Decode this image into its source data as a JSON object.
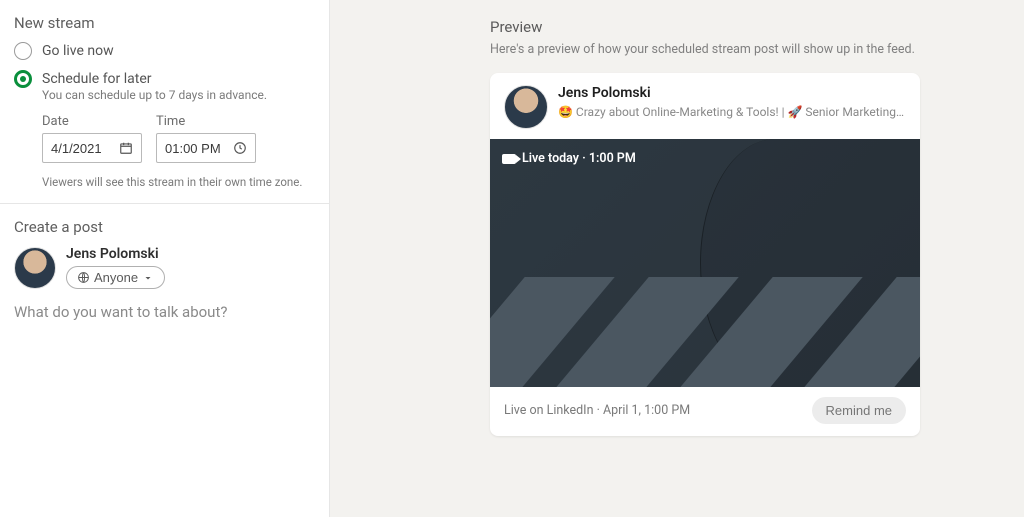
{
  "newStream": {
    "title": "New stream",
    "options": [
      {
        "label": "Go live now",
        "selected": false
      },
      {
        "label": "Schedule for later",
        "selected": true
      }
    ],
    "scheduleNote": "You can schedule up to 7 days in advance.",
    "dateLabel": "Date",
    "dateValue": "4/1/2021",
    "timeLabel": "Time",
    "timeValue": "01:00 PM",
    "timezoneNote": "Viewers will see this stream in their own time zone."
  },
  "createPost": {
    "title": "Create a post",
    "authorName": "Jens Polomski",
    "audienceLabel": "Anyone",
    "placeholder": "What do you want to talk about?"
  },
  "preview": {
    "title": "Preview",
    "description": "Here's a preview of how your scheduled stream post will show up in the feed.",
    "card": {
      "name": "Jens Polomski",
      "tagline": "🤩 Crazy about Online-Marketing & Tools! | 🚀 Senior Marketing Manager at Greator Gm…",
      "badgeText": "Live today · 1:00 PM",
      "footer": "Live on LinkedIn · April 1, 1:00 PM",
      "remindLabel": "Remind me"
    }
  }
}
